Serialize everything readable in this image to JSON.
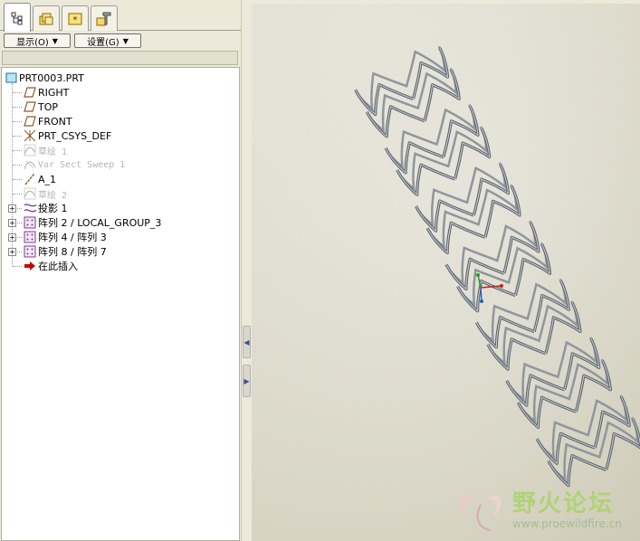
{
  "tabs": [
    {
      "id": "model-tree",
      "icon": "model-tree-icon",
      "active": true
    },
    {
      "id": "layers",
      "icon": "layers-icon",
      "active": false
    },
    {
      "id": "favorites",
      "icon": "favorites-icon",
      "active": false
    },
    {
      "id": "tools",
      "icon": "tools-icon",
      "active": false
    }
  ],
  "toolbar": {
    "show_label": "显示(O)",
    "settings_label": "设置(G)"
  },
  "tree": {
    "root": "PRT0003.PRT",
    "items": [
      {
        "label": "RIGHT",
        "icon": "datum-plane-icon",
        "dim": false,
        "expandable": false
      },
      {
        "label": "TOP",
        "icon": "datum-plane-icon",
        "dim": false,
        "expandable": false
      },
      {
        "label": "FRONT",
        "icon": "datum-plane-icon",
        "dim": false,
        "expandable": false
      },
      {
        "label": "PRT_CSYS_DEF",
        "icon": "coordinate-system-icon",
        "dim": false,
        "expandable": false
      },
      {
        "label": "草绘 1",
        "icon": "sketch-icon",
        "dim": true,
        "expandable": false
      },
      {
        "label": "Var Sect Sweep 1",
        "icon": "sweep-icon",
        "dim": true,
        "expandable": false
      },
      {
        "label": "A_1",
        "icon": "datum-axis-icon",
        "dim": false,
        "expandable": false
      },
      {
        "label": "草绘 2",
        "icon": "sketch-icon",
        "dim": true,
        "expandable": false
      },
      {
        "label": "投影 1",
        "icon": "projection-icon",
        "dim": false,
        "expandable": true
      },
      {
        "label": "阵列 2 / LOCAL_GROUP_3",
        "icon": "pattern-icon",
        "dim": false,
        "expandable": true
      },
      {
        "label": "阵列 4 / 阵列 3",
        "icon": "pattern-icon",
        "dim": false,
        "expandable": true
      },
      {
        "label": "阵列 8 / 阵列 7",
        "icon": "pattern-icon",
        "dim": false,
        "expandable": true
      },
      {
        "label": "在此插入",
        "icon": "insert-here-arrow-icon",
        "dim": false,
        "expandable": false
      }
    ]
  },
  "watermark": {
    "title": "野火论坛",
    "url": "www.proewildfire.cn"
  },
  "colors": {
    "panel_bg": "#ece9d8",
    "viewport_bg": "#dedccd",
    "stent_stroke": "#6f7780",
    "insert_arrow": "#cc0000",
    "datum_plane": "#8a5a2b",
    "pattern": "#7a3d8f"
  }
}
